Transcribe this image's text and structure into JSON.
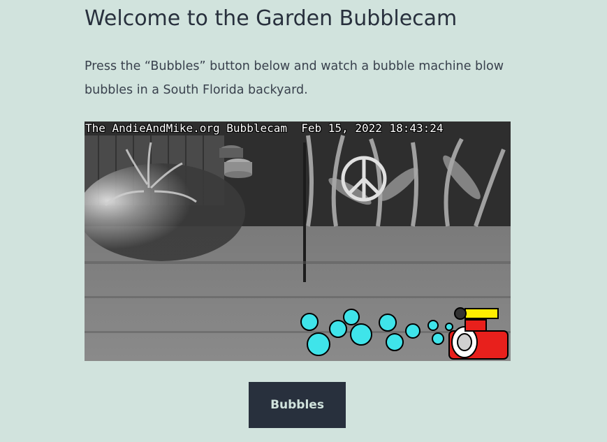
{
  "page": {
    "title": "Welcome to the Garden Bubblecam",
    "intro": "Press the “Bubbles” button below and watch a bubble machine blow bubbles in a South Florida backyard."
  },
  "camera": {
    "site": "The AndieAndMike.org Bubblecam",
    "date": "Feb 15, 2022",
    "time": "18:43:24"
  },
  "actions": {
    "bubbles_label": "Bubbles"
  },
  "colors": {
    "background": "#d1e3dd",
    "button": "#28303d",
    "bubble": "#3fe4ea",
    "machine": "#e8201c"
  }
}
